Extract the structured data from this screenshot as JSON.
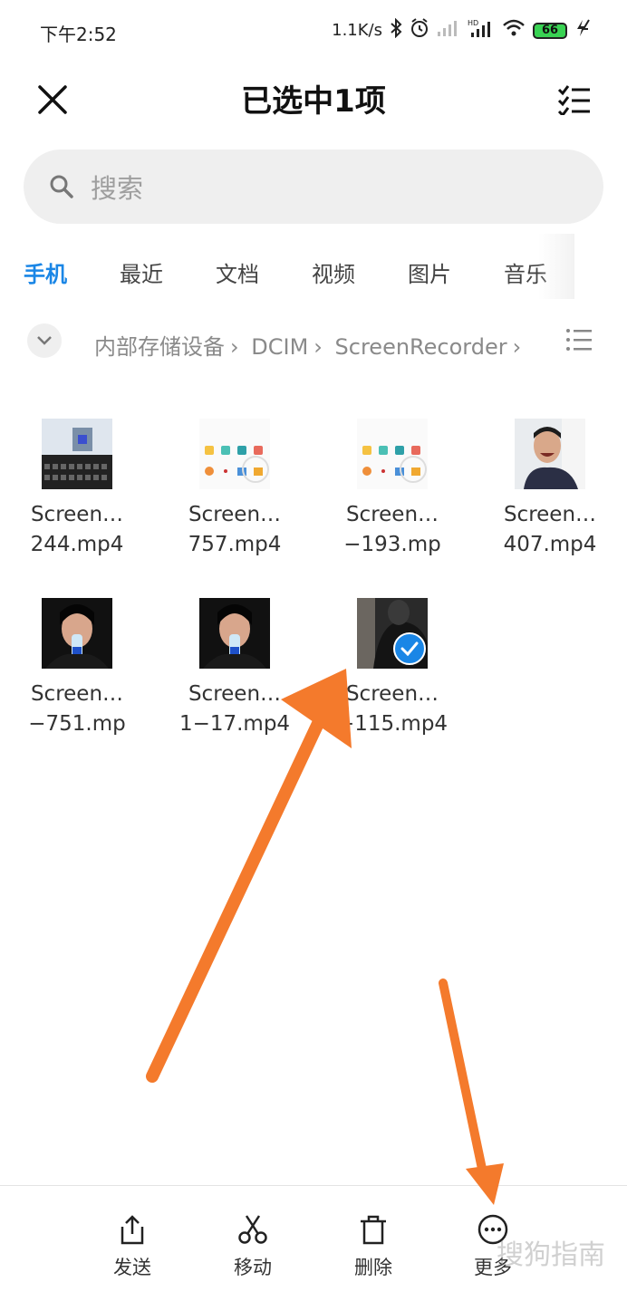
{
  "status_bar": {
    "time": "下午2:52",
    "net_speed": "1.1K/s",
    "battery": "66"
  },
  "header": {
    "title": "已选中1项"
  },
  "search": {
    "placeholder": "搜索"
  },
  "tabs": [
    {
      "label": "手机",
      "active": true
    },
    {
      "label": "最近",
      "active": false
    },
    {
      "label": "文档",
      "active": false
    },
    {
      "label": "视频",
      "active": false
    },
    {
      "label": "图片",
      "active": false
    },
    {
      "label": "音乐",
      "active": false
    }
  ],
  "breadcrumb": {
    "items": [
      "内部存储设备",
      "DCIM",
      "ScreenRecorder"
    ]
  },
  "files": [
    {
      "name_line1": "Screen…",
      "name_line2": "244.mp4",
      "thumb": "keyboard-screenshot",
      "selected": false
    },
    {
      "name_line1": "Screen…",
      "name_line2": "757.mp4",
      "thumb": "app-grid-screenshot",
      "selected": false
    },
    {
      "name_line1": "Screen…",
      "name_line2": "−193.mp",
      "thumb": "app-grid-screenshot",
      "selected": false
    },
    {
      "name_line1": "Screen…",
      "name_line2": "407.mp4",
      "thumb": "person-laughing",
      "selected": false
    },
    {
      "name_line1": "Screen…",
      "name_line2": "−751.mp",
      "thumb": "person-with-bottle",
      "selected": false
    },
    {
      "name_line1": "Screen…",
      "name_line2": "1−17.mp4",
      "thumb": "person-with-bottle",
      "selected": false
    },
    {
      "name_line1": "Screen…",
      "name_line2": "−115.mp4",
      "thumb": "dark-figure",
      "selected": true
    }
  ],
  "bottom_actions": [
    {
      "label": "发送",
      "icon": "share-icon"
    },
    {
      "label": "移动",
      "icon": "scissors-icon"
    },
    {
      "label": "删除",
      "icon": "trash-icon"
    },
    {
      "label": "更多",
      "icon": "more-icon"
    }
  ],
  "watermark": "搜狗指南",
  "colors": {
    "accent": "#1a86e6",
    "annotation_arrow": "#f47a2c"
  }
}
